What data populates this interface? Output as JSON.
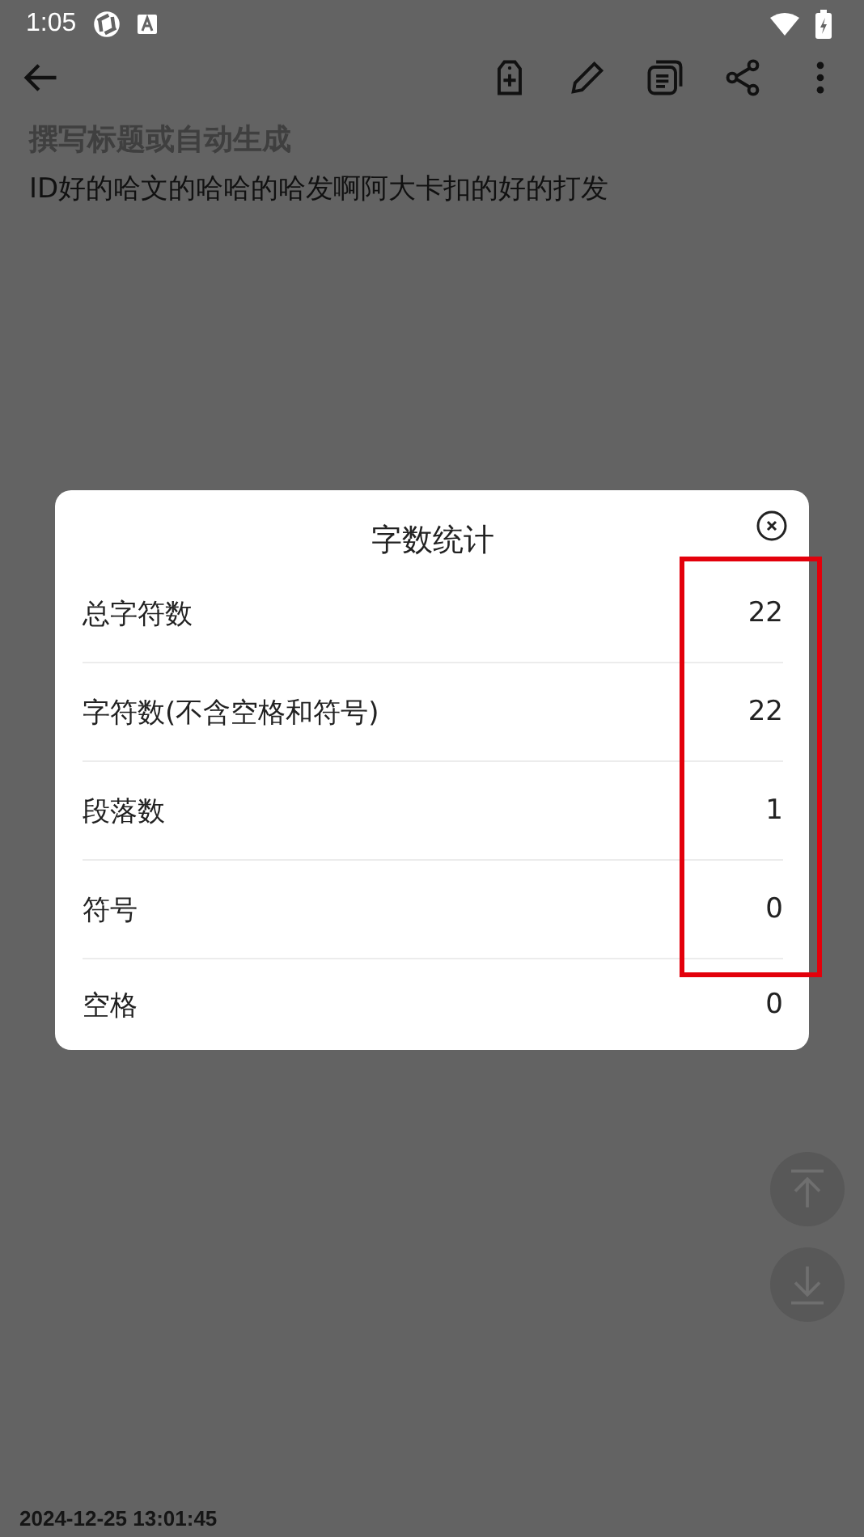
{
  "status_bar": {
    "time": "1:05"
  },
  "note": {
    "title_placeholder": "撰写标题或自动生成",
    "body": "ID好的哈文的哈哈的哈发啊阿大卡扣的好的打发"
  },
  "dialog": {
    "title": "字数统计",
    "rows": [
      {
        "label": "总字符数",
        "value": "22"
      },
      {
        "label": "字符数(不含空格和符号)",
        "value": "22"
      },
      {
        "label": "段落数",
        "value": "1"
      },
      {
        "label": "符号",
        "value": "0"
      },
      {
        "label": "空格",
        "value": "0"
      }
    ]
  },
  "footer": {
    "timestamp": "2024-12-25 13:01:45"
  }
}
